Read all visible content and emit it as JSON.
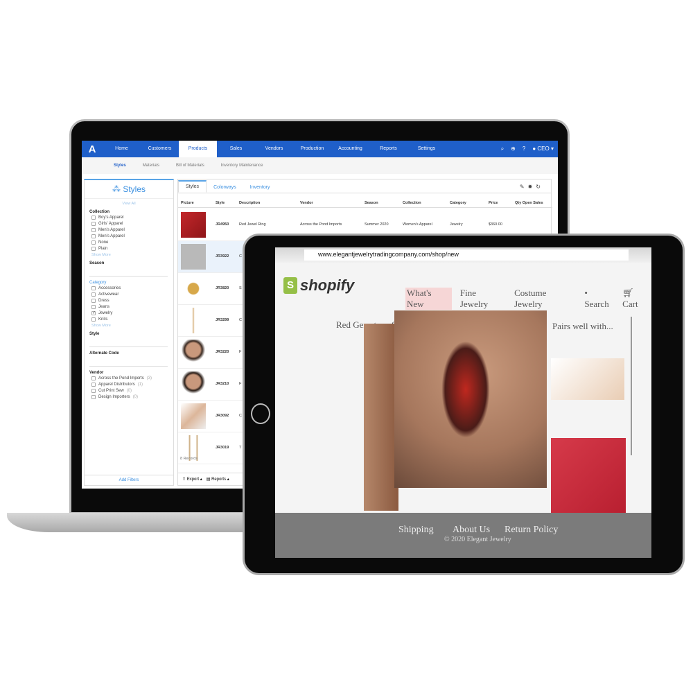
{
  "laptop": {
    "nav": {
      "logo": "A",
      "items": [
        "Home",
        "Customers",
        "Products",
        "Sales",
        "Vendors",
        "Production",
        "Accounting",
        "Reports",
        "Settings"
      ],
      "active": "Products",
      "user": "CEO"
    },
    "subnav": [
      "Styles",
      "Materials",
      "Bill of Materials",
      "Inventory Maintenance"
    ],
    "sidebar": {
      "title": "Styles",
      "view_all": "View All",
      "collection_label": "Collection",
      "collection": [
        "Boy's Apparel",
        "Girls' Apparel",
        "Men's Apparel",
        "Men's Apparel",
        "None",
        "Plain"
      ],
      "show_more": "Show More",
      "season_label": "Season",
      "category_label": "Category",
      "category": [
        "Accessories",
        "Activewear",
        "Dress",
        "Jeans",
        "Jewelry",
        "Knits"
      ],
      "style_label": "Style",
      "alt_code_label": "Alternate Code",
      "vendor_label": "Vendor",
      "vendors": [
        {
          "name": "Across the Pond Imports",
          "count": "(3)"
        },
        {
          "name": "Apparel Distributors",
          "count": "(1)"
        },
        {
          "name": "Cut Print Sew",
          "count": "(0)"
        },
        {
          "name": "Design Importers",
          "count": "(0)"
        }
      ],
      "add_filters": "Add Filters"
    },
    "tabs": [
      "Styles",
      "Colorways",
      "Inventory"
    ],
    "columns": [
      "Picture",
      "Style",
      "Description",
      "Vendor",
      "Season",
      "Collection",
      "Category",
      "Price",
      "Qty Open Sales"
    ],
    "rows": [
      {
        "style": "JR4950",
        "description": "Red Jewel Ring",
        "vendor": "Across the Pond Imports",
        "season": "Summer 2020",
        "collection": "Women's Apparel",
        "category": "Jewelry",
        "price": "$360.00"
      },
      {
        "style": "JR3922",
        "description": "C"
      },
      {
        "style": "JR3820",
        "description": "S"
      },
      {
        "style": "JR3299",
        "description": "C"
      },
      {
        "style": "JR3220",
        "description": "F"
      },
      {
        "style": "JR3210",
        "description": "F"
      },
      {
        "style": "JR3092",
        "description": "C"
      },
      {
        "style": "JR3019",
        "description": "T"
      }
    ],
    "records": "8 Records",
    "export": "Export ▴",
    "reports": "Reports ▴"
  },
  "tablet": {
    "url": "www.elegantjewelrytradingcompany.com/shop/new",
    "logo_text": "shopify",
    "nav": [
      "What's New",
      "Fine Jewelry",
      "Costume Jewelry",
      "Search",
      "Cart"
    ],
    "product_title": "Red Gemstone S",
    "pairs": "Pairs well with...",
    "footer": [
      "Shipping",
      "About Us",
      "Return Policy"
    ],
    "copyright": "© 2020 Elegant Jewelry"
  },
  "colors": {
    "nav_blue": "#1f5fc9",
    "shopify_green": "#95bf47",
    "highlight": "#f6d6d6"
  }
}
